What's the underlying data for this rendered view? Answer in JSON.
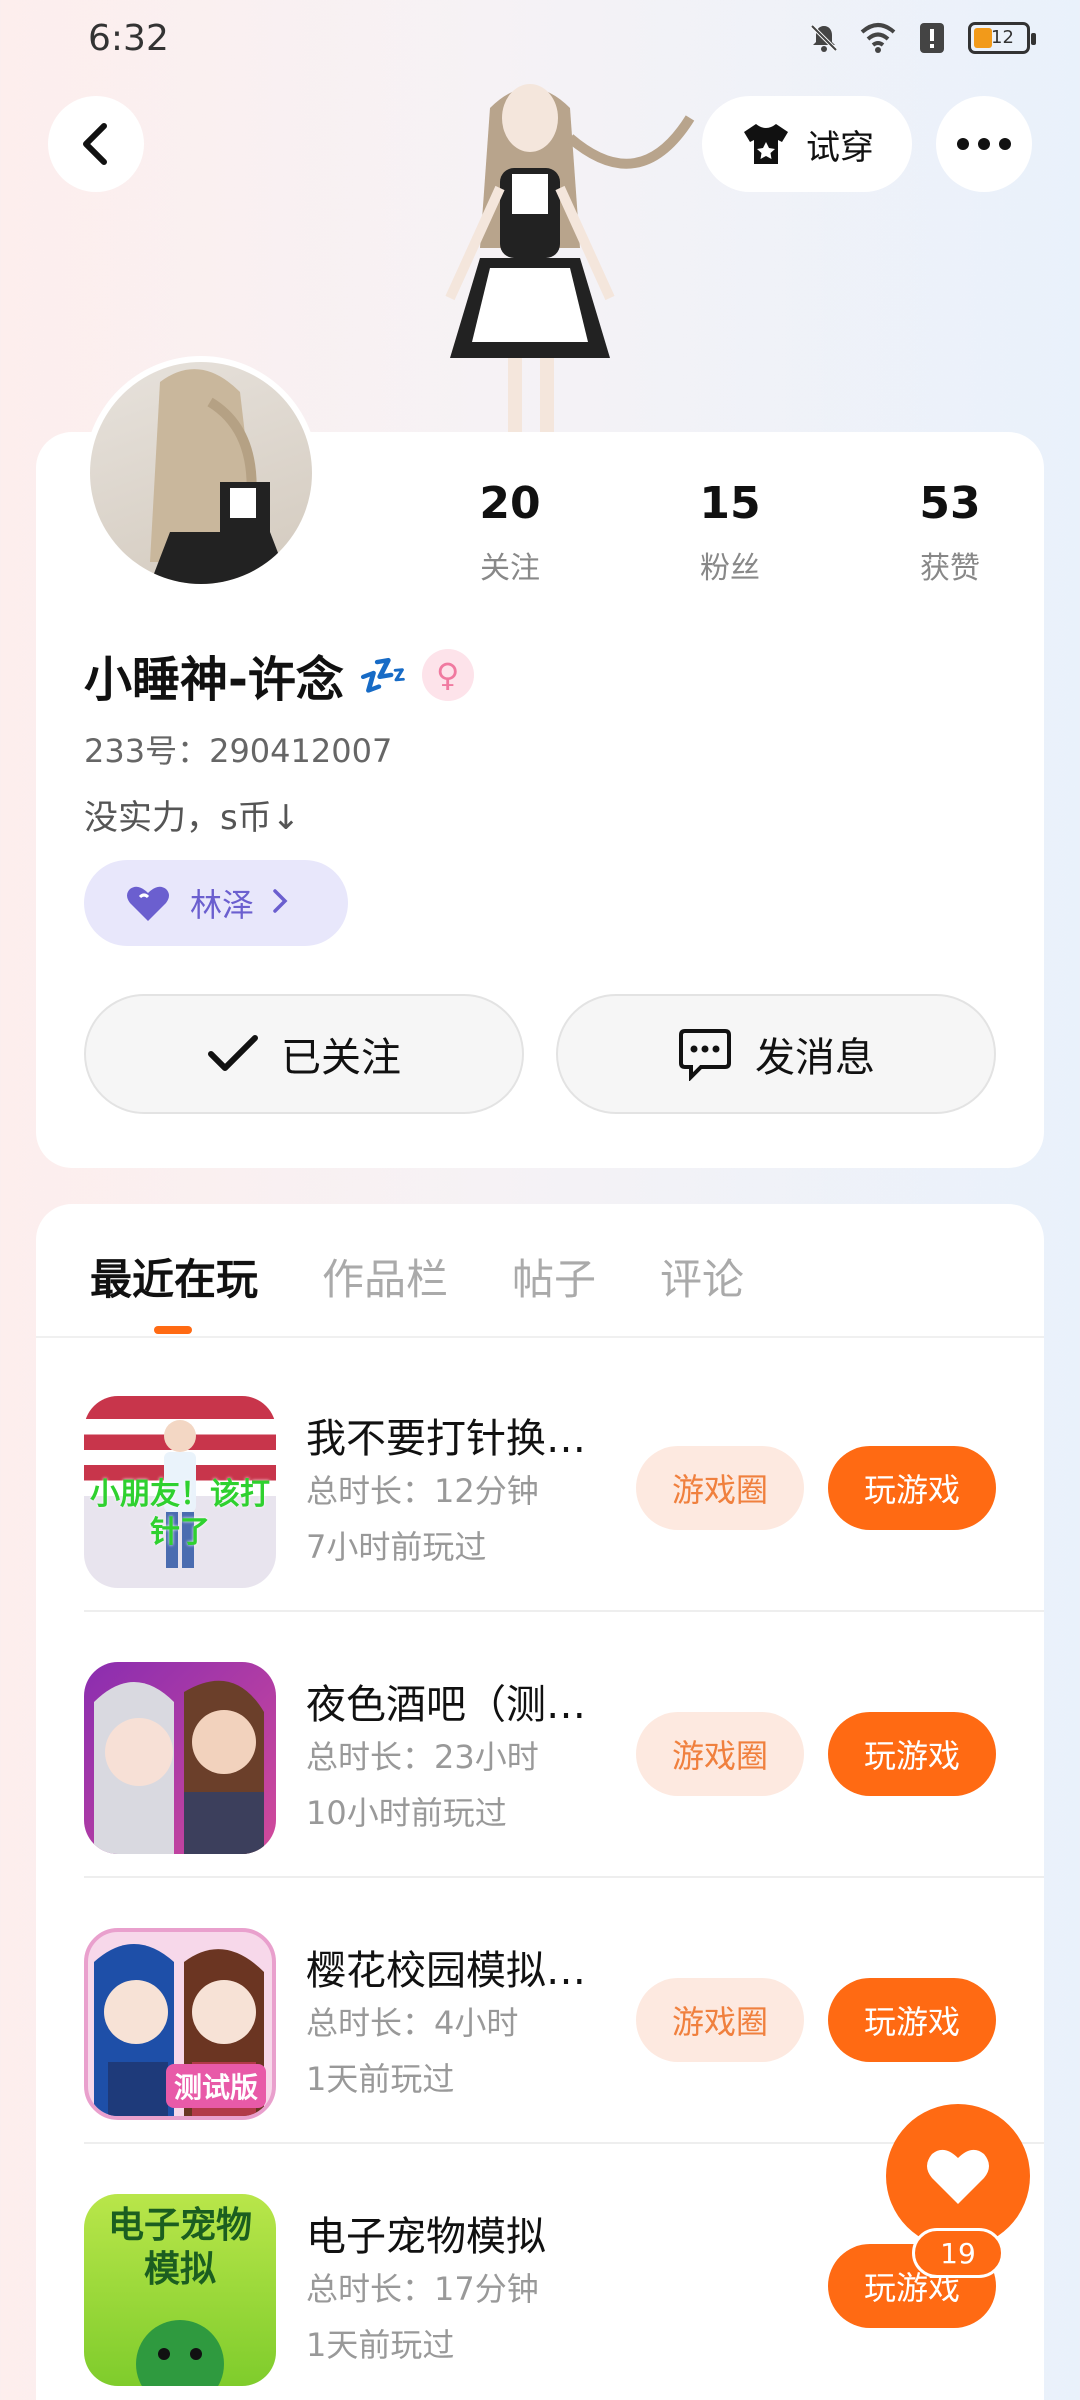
{
  "status_bar": {
    "time": "6:32",
    "battery": "12"
  },
  "header": {
    "try_on_label": "试穿"
  },
  "profile": {
    "name": "小睡神-许念",
    "name_emoji": "💤",
    "gender_symbol": "♀",
    "uid": "233号：290412007",
    "bio": "没实力，s币↓",
    "guild_label": "林泽",
    "stats": [
      {
        "value": "20",
        "label": "关注"
      },
      {
        "value": "15",
        "label": "粉丝"
      },
      {
        "value": "53",
        "label": "获赞"
      }
    ],
    "follow_label": "已关注",
    "message_label": "发消息"
  },
  "tabs": [
    "最近在玩",
    "作品栏",
    "帖子",
    "评论"
  ],
  "games": [
    {
      "title": "我不要打针换…",
      "duration": "总时长：12分钟",
      "last_played": "7小时前玩过",
      "icon_text": "小朋友！该打针了",
      "circle_label": "游戏圈",
      "play_label": "玩游戏"
    },
    {
      "title": "夜色酒吧（测…",
      "duration": "总时长：23小时",
      "last_played": "10小时前玩过",
      "icon_text": "",
      "circle_label": "游戏圈",
      "play_label": "玩游戏"
    },
    {
      "title": "樱花校园模拟…",
      "duration": "总时长：4小时",
      "last_played": "1天前玩过",
      "icon_text": "测试版",
      "circle_label": "游戏圈",
      "play_label": "玩游戏"
    },
    {
      "title": "电子宠物模拟",
      "duration": "总时长：17分钟",
      "last_played": "1天前玩过",
      "icon_text": "电子宠物模拟",
      "circle_label": "",
      "play_label": "玩游戏"
    }
  ],
  "like_fab": {
    "count": "19"
  },
  "colors": {
    "accent": "#ff6a13",
    "accent_soft": "#fde9e0",
    "guild_bg": "#e8e7fb",
    "guild_text": "#6b5fcf"
  }
}
